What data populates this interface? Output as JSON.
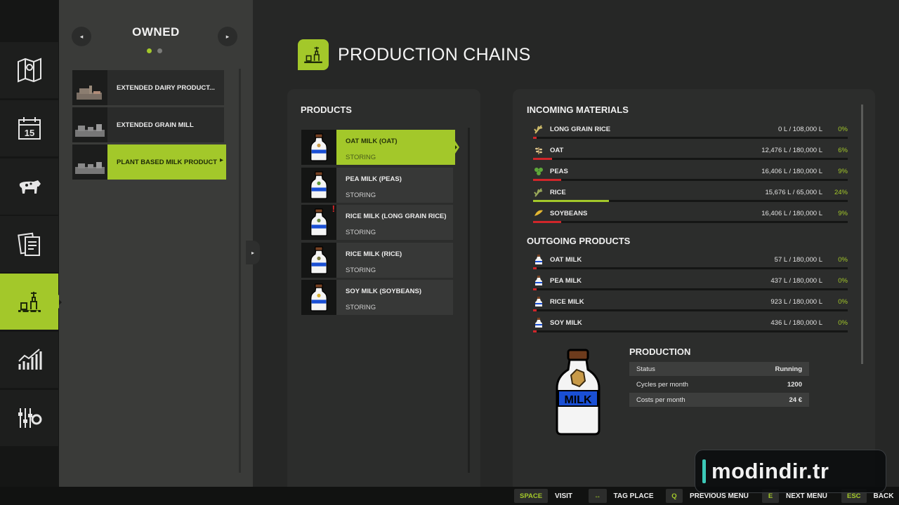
{
  "nav": {
    "items": [
      {
        "name": "map-icon"
      },
      {
        "name": "calendar-icon",
        "text": "15"
      },
      {
        "name": "cow-icon"
      },
      {
        "name": "contracts-icon"
      },
      {
        "name": "production-icon",
        "active": true
      },
      {
        "name": "statistics-icon"
      },
      {
        "name": "settings-icon"
      }
    ]
  },
  "owned": {
    "title": "OWNED",
    "prev_label": "◂",
    "next_label": "▸",
    "page_count": 2,
    "current_page": 1,
    "facilities": [
      {
        "label": "EXTENDED DAIRY PRODUCT..."
      },
      {
        "label": "EXTENDED GRAIN MILL"
      },
      {
        "label": "PLANT BASED MILK PRODUCT",
        "active": true
      }
    ],
    "collapse_label": "▸"
  },
  "header": {
    "title": "PRODUCTION CHAINS"
  },
  "products": {
    "title": "PRODUCTS",
    "items": [
      {
        "name": "OAT MILK (OAT)",
        "state": "STORING",
        "active": true,
        "warning": ""
      },
      {
        "name": "PEA MILK (PEAS)",
        "state": "STORING",
        "warning": ""
      },
      {
        "name": "RICE MILK (LONG GRAIN RICE)",
        "state": "STORING",
        "warning": "!"
      },
      {
        "name": "RICE MILK (RICE)",
        "state": "STORING",
        "warning": ""
      },
      {
        "name": "SOY MILK (SOYBEANS)",
        "state": "STORING",
        "warning": ""
      }
    ],
    "bottle_label": "MILK"
  },
  "incoming": {
    "title": "INCOMING MATERIALS",
    "items": [
      {
        "name": "LONG GRAIN RICE",
        "amount": "0 L / 108,000 L",
        "percent": "0%",
        "fill": 0.0,
        "icon": "rice-grain-icon"
      },
      {
        "name": "OAT",
        "amount": "12,476 L / 180,000 L",
        "percent": "6%",
        "fill": 0.06,
        "icon": "oat-icon"
      },
      {
        "name": "PEAS",
        "amount": "16,406 L / 180,000 L",
        "percent": "9%",
        "fill": 0.09,
        "icon": "peas-icon"
      },
      {
        "name": "RICE",
        "amount": "15,676 L / 65,000 L",
        "percent": "24%",
        "fill": 0.24,
        "icon": "rice-icon"
      },
      {
        "name": "SOYBEANS",
        "amount": "16,406 L / 180,000 L",
        "percent": "9%",
        "fill": 0.09,
        "icon": "soybean-icon"
      }
    ]
  },
  "outgoing": {
    "title": "OUTGOING PRODUCTS",
    "items": [
      {
        "name": "OAT MILK",
        "amount": "57 L / 180,000 L",
        "percent": "0%",
        "fill": 0.0
      },
      {
        "name": "PEA MILK",
        "amount": "437 L / 180,000 L",
        "percent": "0%",
        "fill": 0.0
      },
      {
        "name": "RICE MILK",
        "amount": "923 L / 180,000 L",
        "percent": "0%",
        "fill": 0.0
      },
      {
        "name": "SOY MILK",
        "amount": "436 L / 180,000 L",
        "percent": "0%",
        "fill": 0.0
      }
    ]
  },
  "production": {
    "title": "PRODUCTION",
    "bottle_label": "MILK",
    "status_label": "Status",
    "status_value": "Running",
    "cycles_label": "Cycles per month",
    "cycles_value": "1200",
    "costs_label": "Costs per month",
    "costs_value": "24 €"
  },
  "hints": [
    {
      "key": "SPACE",
      "label": "VISIT"
    },
    {
      "key": "↔",
      "label": "TAG PLACE"
    },
    {
      "key": "Q",
      "label": "PREVIOUS MENU"
    },
    {
      "key": "E",
      "label": "NEXT MENU"
    },
    {
      "key": "ESC",
      "label": "BACK"
    }
  ],
  "watermark": {
    "text": "modindir.tr"
  },
  "colors": {
    "accent": "#a3c82a",
    "low": "#d1262a",
    "mid": "#a3c82a"
  }
}
